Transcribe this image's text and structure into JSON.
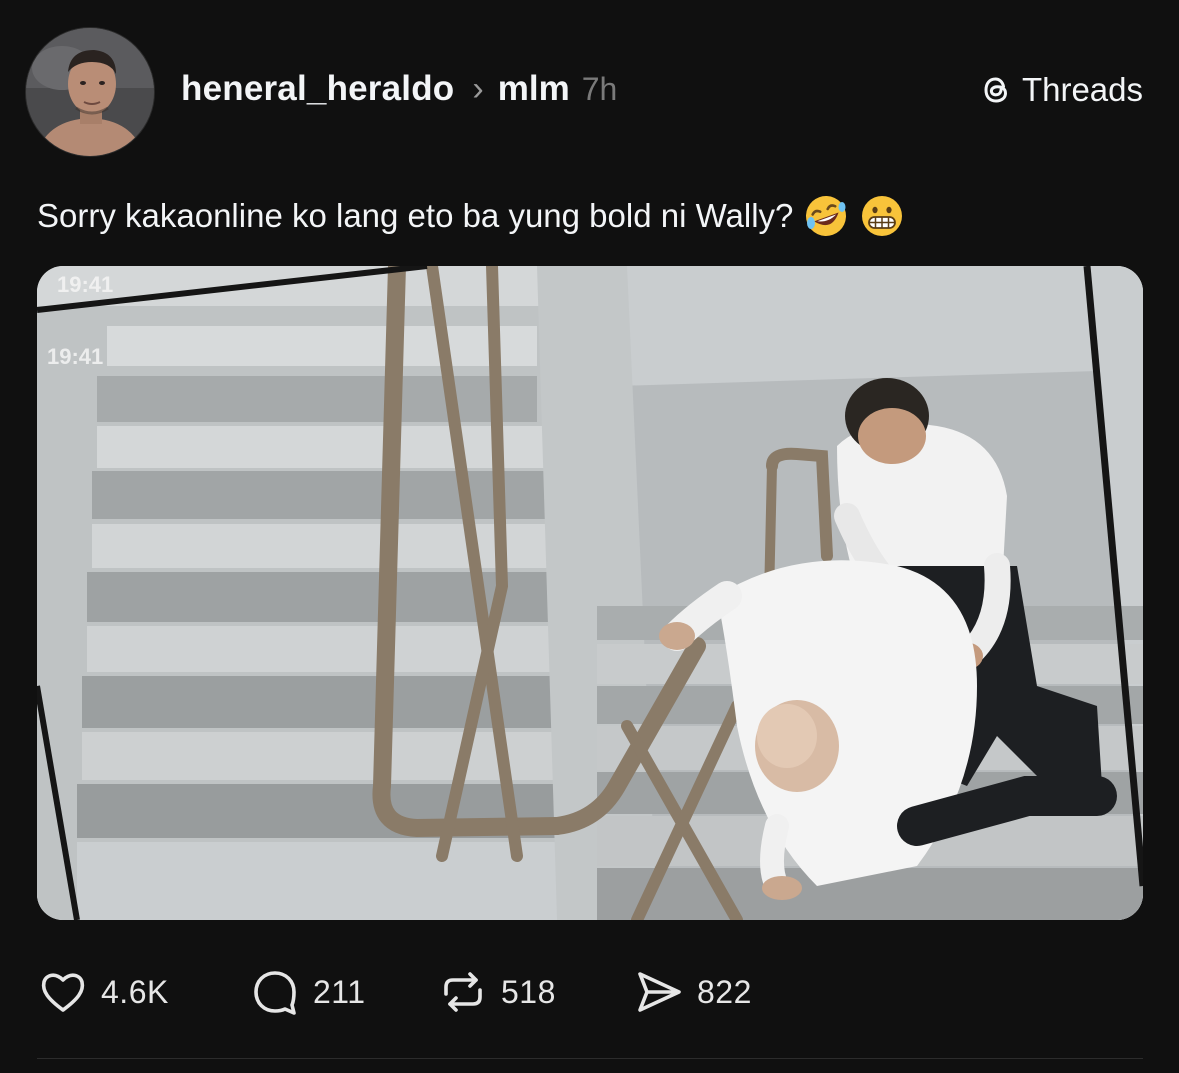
{
  "post": {
    "username": "heneral_heraldo",
    "separator": "›",
    "topic": "mlm",
    "time": "7h",
    "brand": "Threads",
    "brand_icon": "threads-logo-icon",
    "caption": "Sorry kakaonline ko lang eto ba yung bold ni Wally?",
    "caption_emojis": [
      "rolling-on-floor-laughing-emoji",
      "grimacing-face-emoji"
    ],
    "image_timestamps": [
      "19:41",
      "19:41"
    ]
  },
  "actions": {
    "likes": {
      "icon": "heart-icon",
      "count": "4.6K"
    },
    "replies": {
      "icon": "comment-icon",
      "count": "211"
    },
    "reposts": {
      "icon": "repost-icon",
      "count": "518"
    },
    "shares": {
      "icon": "send-icon",
      "count": "822"
    }
  },
  "colors": {
    "background": "#101010",
    "text_primary": "#f3f5f7",
    "text_secondary": "#7a7a7a"
  }
}
